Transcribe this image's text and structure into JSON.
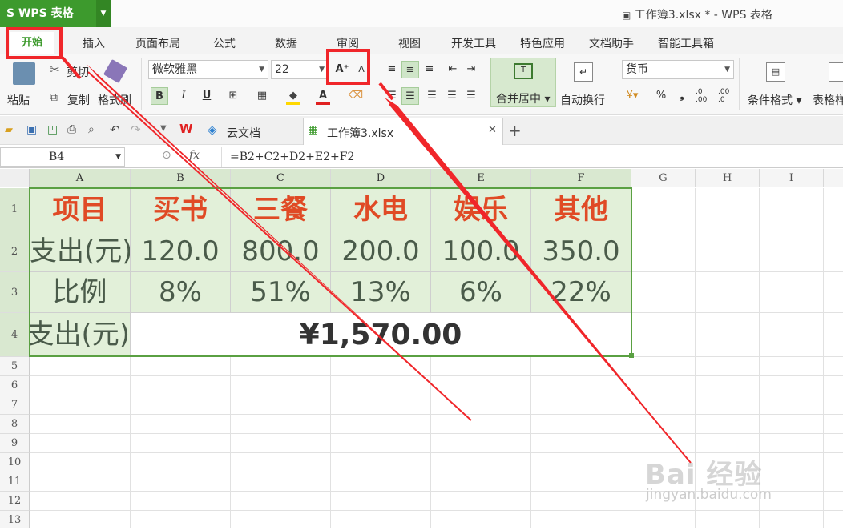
{
  "app": {
    "name": "S WPS 表格",
    "doc_title": "工作簿3.xlsx * - WPS 表格"
  },
  "menu_tabs": [
    "开始",
    "插入",
    "页面布局",
    "公式",
    "数据",
    "审阅",
    "视图",
    "开发工具",
    "特色应用",
    "文档助手",
    "智能工具箱"
  ],
  "ribbon": {
    "paste": "粘贴",
    "cut": "剪切",
    "copy": "复制",
    "format_painter": "格式刷",
    "font_name": "微软雅黑",
    "font_size": "22",
    "bold": "B",
    "italic": "I",
    "underline": "U",
    "grow_font": "A⁺",
    "shrink_font": "A",
    "merge_center": "合并居中",
    "wrap_text": "自动换行",
    "number_format": "货币",
    "percent": "%",
    "comma": "❟",
    "inc_decimal": ".0 .00",
    "dec_decimal": ".00 .0",
    "conditional_format": "条件格式",
    "table_style": "表格样"
  },
  "doc_tabs": [
    {
      "label": "云文档"
    },
    {
      "label": "工作簿3.xlsx"
    }
  ],
  "formula_bar": {
    "cell_ref": "B4",
    "fx": "fx",
    "formula": "=B2+C2+D2+E2+F2"
  },
  "columns": [
    "A",
    "B",
    "C",
    "D",
    "E",
    "F",
    "G",
    "H",
    "I"
  ],
  "rows": [
    "1",
    "2",
    "3",
    "4",
    "5",
    "6",
    "7",
    "8",
    "9",
    "10",
    "11",
    "12",
    "13"
  ],
  "sheet": {
    "row1": [
      "项目",
      "买书",
      "三餐",
      "水电",
      "娱乐",
      "其他"
    ],
    "row2": [
      "支出(元)",
      "120.0",
      "800.0",
      "200.0",
      "100.0",
      "350.0"
    ],
    "row3": [
      "比例",
      "8%",
      "51%",
      "13%",
      "6%",
      "22%"
    ],
    "row4_label": "总支出(元)",
    "row4_total": "¥1,570.00"
  },
  "watermark": {
    "brand": "Bai 经验",
    "url": "jingyan.baidu.com"
  },
  "colors": {
    "accent": "#3d9a2d",
    "annotation": "#f0262a",
    "header_text": "#e04a25",
    "table_fill": "#e2f0d9"
  }
}
